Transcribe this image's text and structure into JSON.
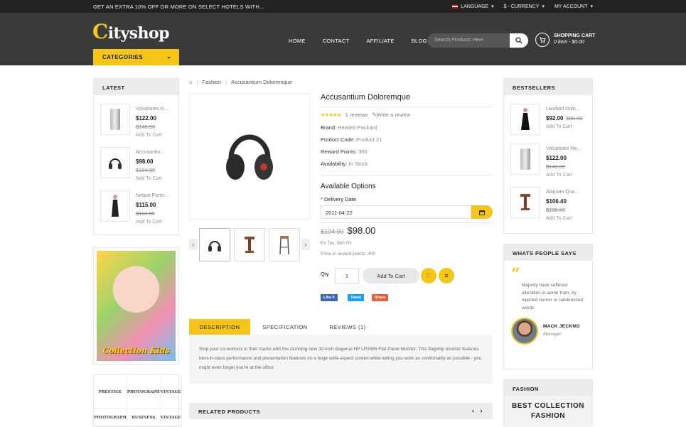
{
  "topbar": {
    "promo": "GET AN EXTRA 10% OFF OR MORE ON SELECT HOTELS WITH...",
    "language": "LANGUAGE",
    "currency": "$ - CURRENCY",
    "account": "MY ACCOUNT"
  },
  "header": {
    "logo_first": "C",
    "logo_rest": "ityshop",
    "nav": [
      "HOME",
      "CONTACT",
      "AFFILIATE",
      "BLOGS"
    ],
    "search_placeholder": "Search Products Here",
    "cart_title": "SHOPPING CART",
    "cart_summary": "0 item - $0.00",
    "categories": "CATEGORIES"
  },
  "latest": {
    "title": "LATEST",
    "items": [
      {
        "name": "Voluptates R...",
        "price": "$122.00",
        "old": "$140.00",
        "action": "Add To Cart"
      },
      {
        "name": "Accusantiu...",
        "price": "$98.00",
        "old": "$104.00",
        "action": "Add To Cart"
      },
      {
        "name": "Neque Porro...",
        "price": "$115.00",
        "old": "$118.00",
        "action": "Add To Cart"
      }
    ]
  },
  "banner": {
    "text": "Collection Kids"
  },
  "brands": [
    "PRESTIGE",
    "PHOTOGRAPH",
    "VINTAGE",
    "PHOTOGRAPH",
    "BUSINESS",
    "VINTAGE"
  ],
  "breadcrumb": [
    "Fashion",
    "Accusantium Doloremque"
  ],
  "product": {
    "title": "Accusantium Doloremque",
    "stars": "★★★★★",
    "reviews": "1 reviews",
    "write_review": "Write a review",
    "brand_label": "Brand:",
    "brand": "Hewlett-Packard",
    "code_label": "Product Code:",
    "code": "Product 21",
    "points_label": "Reward Points:",
    "points": "300",
    "avail_label": "Availability:",
    "avail": "In Stock",
    "options_title": "Available Options",
    "delivery_label": "Delivery Date",
    "delivery_value": "2011-04-22",
    "old_price": "$104.00",
    "price": "$98.00",
    "ex_tax": "Ex Tax: $80.00",
    "reward_price": "Price in reward points: 400",
    "qty_label": "Qty",
    "qty": "1",
    "add_to_cart": "Add To Cart",
    "share": {
      "like": "Like 0",
      "tweet": "Tweet",
      "share": "Share"
    }
  },
  "tabs": [
    "DESCRIPTION",
    "SPECIFICATION",
    "REVIEWS (1)"
  ],
  "description": "Stop your co-workers in their tracks with the stunning new 30-inch diagonal HP LP3065 Flat Panel Monitor. This flagship monitor features best-in-class performance and presentation features on a huge wide-aspect screen while letting you work as comfortably as possible - you might even forget you're at the office",
  "related": "RELATED PRODUCTS",
  "bestsellers": {
    "title": "BESTSELLERS",
    "items": [
      {
        "name": "Laudant Dolo...",
        "price": "$92.00",
        "old": "$98.00",
        "action": "Add To Cart"
      },
      {
        "name": "Voluptates Re...",
        "price": "$122.00",
        "old": "$140.00",
        "action": "Add To Cart"
      },
      {
        "name": "Aliquam Qua...",
        "price": "$106.40",
        "old": "$108.80",
        "action": "Add To Cart"
      }
    ]
  },
  "testimonial": {
    "title": "WHATS PEOPLE SAYS",
    "text": "Majority have suffered alteration in aome from, by injected humor or randomized words",
    "name": "MACK JECKNO",
    "role": "Manager"
  },
  "fashion": {
    "title": "FASHION",
    "line1": "BEST COLLECTION",
    "line2": "FASHION"
  }
}
